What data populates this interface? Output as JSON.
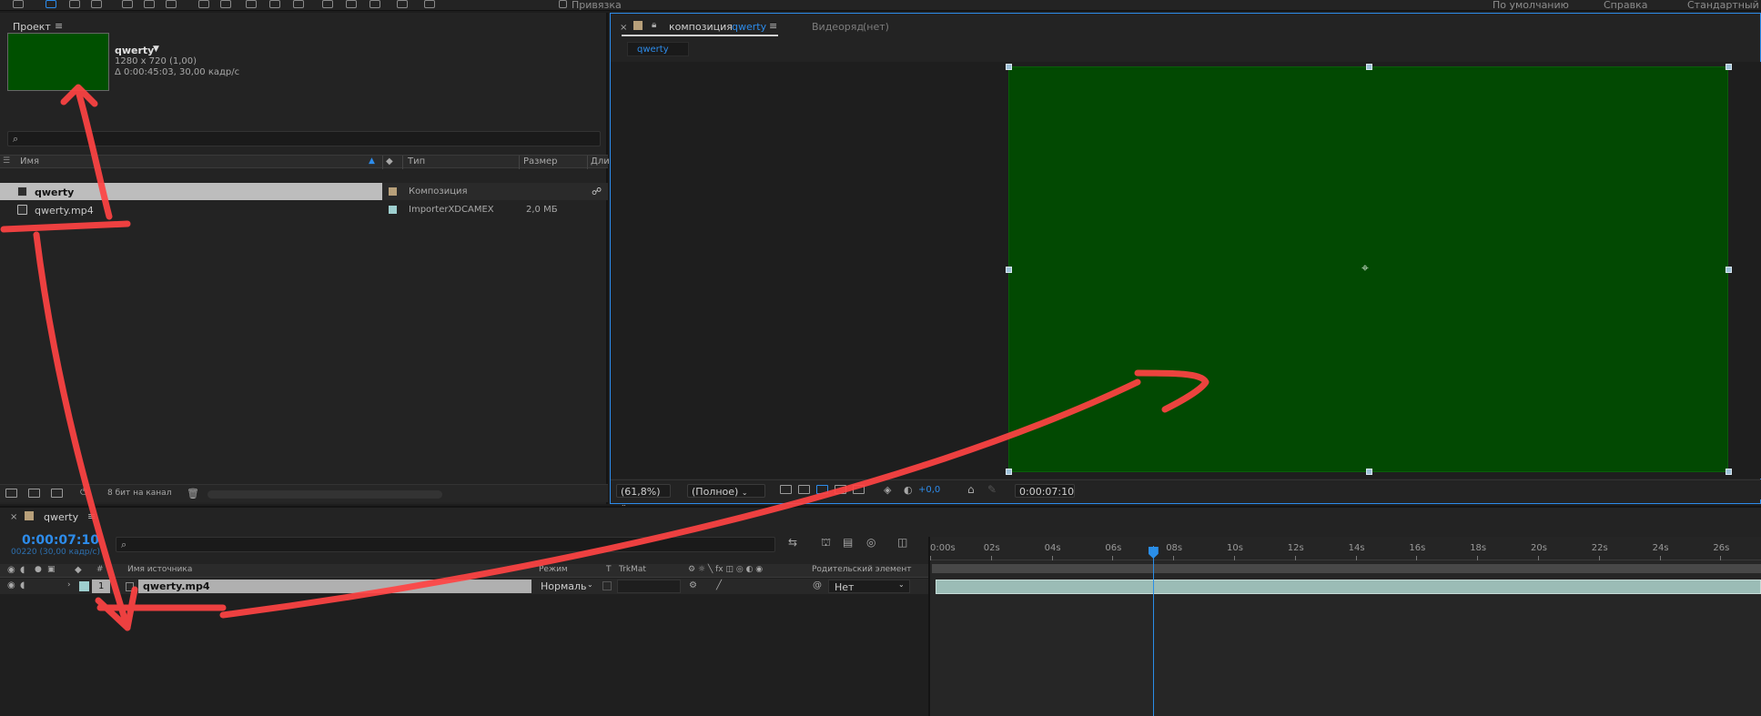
{
  "toolbar": {
    "snap_label": "Привязка",
    "workspaces": [
      "По умолчанию",
      "Справка",
      "Стандартный"
    ]
  },
  "project": {
    "tab_label": "Проект",
    "preview": {
      "name": "qwerty",
      "resolution": "1280 x 720 (1,00)",
      "duration": "Δ 0:00:45:03, 30,00 кадр/с"
    },
    "columns": {
      "name": "Имя",
      "type": "Тип",
      "size": "Размер",
      "duration": "Дли"
    },
    "items": [
      {
        "name": "qwerty",
        "type": "Композиция",
        "size": "",
        "swatch_color": "#b8a07a"
      },
      {
        "name": "qwerty.mp4",
        "type": "ImporterXDCAMEX",
        "size": "2,0 МБ",
        "swatch_color": "#9ecfcf"
      }
    ],
    "footer": {
      "bit_depth": "8 бит на канал"
    }
  },
  "composition": {
    "tab_prefix": "композиция",
    "tab_name": "qwerty",
    "footage_tab": "Видеоряд",
    "footage_value": "(нет)",
    "breadcrumb": "qwerty",
    "canvas_color": "#024902",
    "footer": {
      "zoom": "(61,8%)",
      "resolution": "(Полное)",
      "exposure": "+0,0",
      "timecode": "0:00:07:10"
    }
  },
  "timeline": {
    "tab_name": "qwerty",
    "timecode": "0:00:07:10",
    "frames_info": "00220 (30,00 кадр/с)",
    "columns": {
      "number": "#",
      "source": "Имя источника",
      "mode": "Режим",
      "t": "T",
      "trkmat": "TrkMat",
      "parent": "Родительский элемент"
    },
    "layers": [
      {
        "number": "1",
        "name": "qwerty.mp4",
        "mode": "Нормаль",
        "parent": "Нет",
        "label_color": "#9ecfcf"
      }
    ],
    "ruler_labels": [
      "0:00s",
      "02s",
      "04s",
      "06s",
      "08s",
      "10s",
      "12s",
      "14s",
      "16s",
      "18s",
      "20s",
      "22s",
      "24s",
      "26s"
    ],
    "playhead_seconds": 7.33
  }
}
